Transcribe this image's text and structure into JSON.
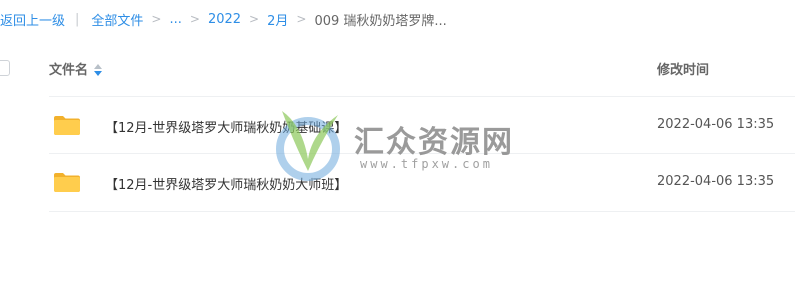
{
  "breadcrumb": {
    "back": "返回上一级",
    "divider": "|",
    "items": [
      "全部文件",
      "...",
      "2022",
      "2月"
    ],
    "current": "009 瑞秋奶奶塔罗牌..."
  },
  "table": {
    "columns": {
      "name": "文件名",
      "modified": "修改时间"
    },
    "rows": [
      {
        "name": "【12月-世界级塔罗大师瑞秋奶奶基础课】",
        "modified": "2022-04-06 13:35",
        "icon": "folder-icon"
      },
      {
        "name": "【12月-世界级塔罗大师瑞秋奶奶大师班】",
        "modified": "2022-04-06 13:35",
        "icon": "folder-icon"
      }
    ]
  },
  "watermark": {
    "title": "汇众资源网",
    "url": "www.tfpxw.com"
  },
  "colors": {
    "link": "#2e8ee6",
    "folder": "#f7c13b",
    "row_border": "#eef0f2"
  }
}
